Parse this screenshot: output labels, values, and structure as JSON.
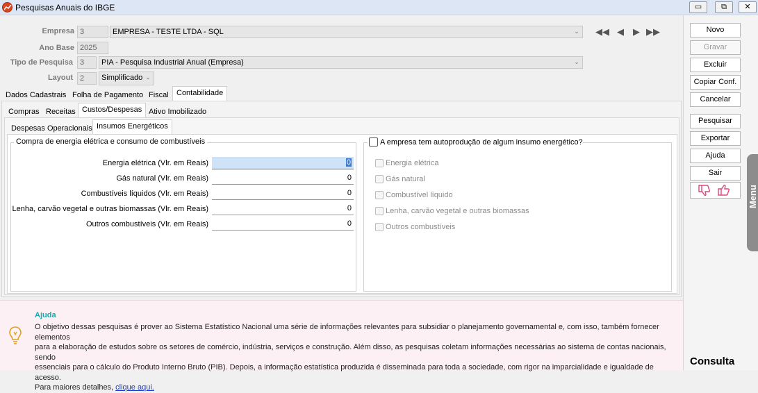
{
  "window": {
    "title": "Pesquisas Anuais do IBGE",
    "controls": [
      "▭",
      "⧉",
      "✕"
    ]
  },
  "header": {
    "empresa": {
      "label": "Empresa",
      "code": "3",
      "value": "EMPRESA - TESTE LTDA - SQL"
    },
    "ano_base": {
      "label": "Ano Base",
      "value": "2025"
    },
    "tipo_pesquisa": {
      "label": "Tipo de Pesquisa",
      "code": "3",
      "value": "PIA - Pesquisa Industrial Anual (Empresa)"
    },
    "layout": {
      "label": "Layout",
      "code": "2",
      "value": "Simplificado"
    }
  },
  "tabs_level1": [
    "Dados Cadastrais",
    "Folha de Pagamento",
    "Fiscal",
    "Contabilidade"
  ],
  "tabs_level2": [
    "Compras",
    "Receitas",
    "Custos/Despesas",
    "Ativo Imobilizado"
  ],
  "tabs_level3": [
    "Despesas Operacionais",
    "Insumos Energéticos"
  ],
  "left_group": {
    "title": "Compra de energia elétrica e consumo de combustíveis",
    "rows": [
      {
        "label": "Energia elétrica (Vlr. em Reais)",
        "value": "0"
      },
      {
        "label": "Gás natural (Vlr. em Reais)",
        "value": "0"
      },
      {
        "label": "Combustíveis líquidos (Vlr. em Reais)",
        "value": "0"
      },
      {
        "label": "Lenha, carvão vegetal e outras biomassas (Vlr. em Reais)",
        "value": "0"
      },
      {
        "label": "Outros combustíveis (Vlr. em Reais)",
        "value": "0"
      }
    ]
  },
  "right_group": {
    "title": "A empresa tem autoprodução de algum insumo energético?",
    "options": [
      "Energia elétrica",
      "Gás natural",
      "Combustível líquido",
      "Lenha, carvão vegetal e outras biomassas",
      "Outros combustíveis"
    ]
  },
  "help": {
    "title": "Ajuda",
    "line1": "O objetivo dessas pesquisas é prover ao Sistema Estatístico Nacional uma série de informações relevantes para subsidiar o planejamento governamental e, com isso, também fornecer elementos",
    "line2": "para a elaboração de estudos sobre os setores de comércio, indústria, serviços e construção. Além disso, as pesquisas coletam informações necessárias ao sistema de contas nacionais, sendo",
    "line3": "essenciais para o cálculo do Produto Interno Bruto (PIB). Depois, a informação estatística produzida é disseminada para toda a sociedade, com rigor na imparcialidade e igualdade de acesso.",
    "line4_prefix": "Para maiores detalhes, ",
    "link": "clique aqui."
  },
  "sidebar": {
    "buttons": [
      "Novo",
      "Gravar",
      "Excluir",
      "Copiar Conf.",
      "Cancelar",
      "Pesquisar",
      "Exportar",
      "Ajuda",
      "Sair"
    ],
    "menu_label": "Menu",
    "mode_label": "Consulta"
  },
  "colors": {
    "help_bg": "#fcf0f4",
    "help_title": "#1aa8a8",
    "focus_field": "#cfe3f8",
    "app_icon": "#d9461f",
    "thumbs": "#e0457b"
  }
}
